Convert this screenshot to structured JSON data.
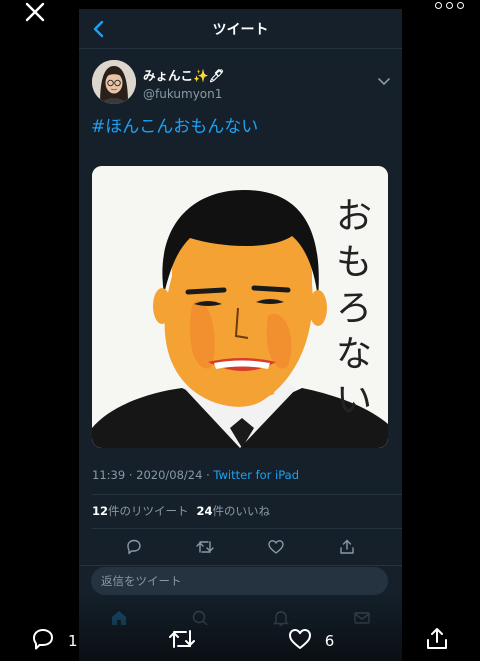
{
  "viewer": {
    "reply_count": "1",
    "like_count": "6"
  },
  "nav": {
    "title": "ツイート"
  },
  "author": {
    "display_name": "みょんこ✨🖊",
    "handle": "@fukumyon1"
  },
  "tweet": {
    "text": "#ほんこんおもんない",
    "image_handwriting": "おもろない"
  },
  "meta": {
    "time": "11:39",
    "date": "2020/08/24",
    "separator": "·",
    "source": "Twitter for iPad"
  },
  "stats": {
    "retweets_num": "12",
    "retweets_label": "件のリツイート",
    "likes_num": "24",
    "likes_label": "件のいいね"
  },
  "reply": {
    "placeholder": "返信をツイート"
  },
  "colors": {
    "accent": "#1da1f2",
    "background": "#15202b",
    "viewer_background": "#000000",
    "secondary_text": "#8899a6"
  },
  "icons": [
    "close-icon",
    "more-icon",
    "back-icon",
    "chevron-down-icon",
    "reply-icon",
    "retweet-icon",
    "like-icon",
    "share-icon",
    "home-icon",
    "search-icon",
    "notifications-icon",
    "messages-icon"
  ]
}
